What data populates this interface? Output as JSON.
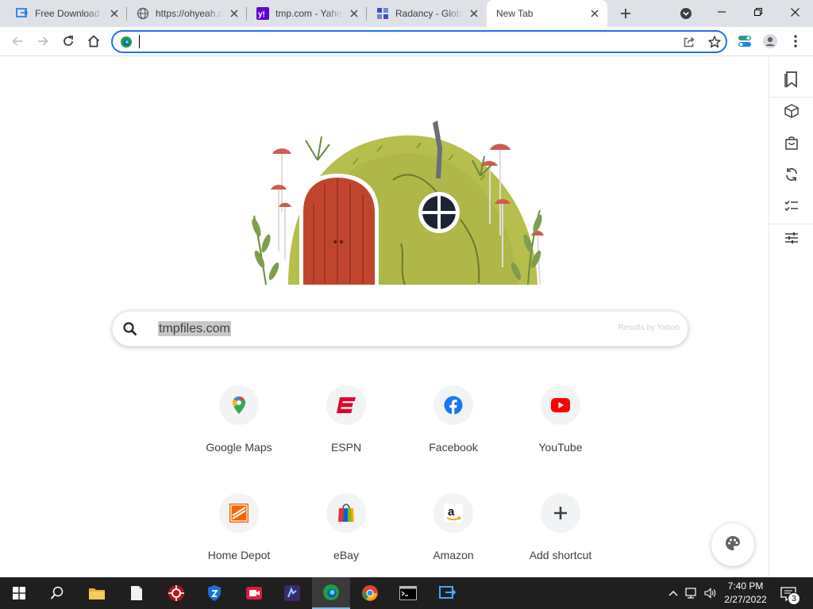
{
  "tabs": [
    {
      "title": "Free Download Manager",
      "icon": "fdm-icon"
    },
    {
      "title": "https://ohyeah.media",
      "icon": "globe-icon"
    },
    {
      "title": "tmp.com - Yahoo",
      "icon": "yahoo-icon"
    },
    {
      "title": "Radancy - Global",
      "icon": "radancy-icon"
    },
    {
      "title": "New Tab",
      "icon": "",
      "active": true
    }
  ],
  "omnibox": {
    "value": "",
    "placeholder": ""
  },
  "search": {
    "text": "tmpfiles.com",
    "attribution": "Results by Yahoo"
  },
  "shortcuts": [
    {
      "label": "Google Maps",
      "icon": "google-maps-icon"
    },
    {
      "label": "ESPN",
      "icon": "espn-icon"
    },
    {
      "label": "Facebook",
      "icon": "facebook-icon"
    },
    {
      "label": "YouTube",
      "icon": "youtube-icon"
    },
    {
      "label": "Home Depot",
      "icon": "home-depot-icon"
    },
    {
      "label": "eBay",
      "icon": "ebay-icon"
    },
    {
      "label": "Amazon",
      "icon": "amazon-icon"
    },
    {
      "label": "Add shortcut",
      "icon": "plus-icon"
    }
  ],
  "sidebar": [
    "bookmark-icon",
    "cube-icon",
    "shopping-bag-icon",
    "sync-icon",
    "checklist-icon",
    "sliders-icon"
  ],
  "taskbar": {
    "time": "7:40 PM",
    "date": "2/27/2022",
    "notification_count": "3"
  },
  "colors": {
    "accent": "#1a73e8",
    "tabstrip": "#dee1e6",
    "taskbar": "#1f1f1f"
  }
}
